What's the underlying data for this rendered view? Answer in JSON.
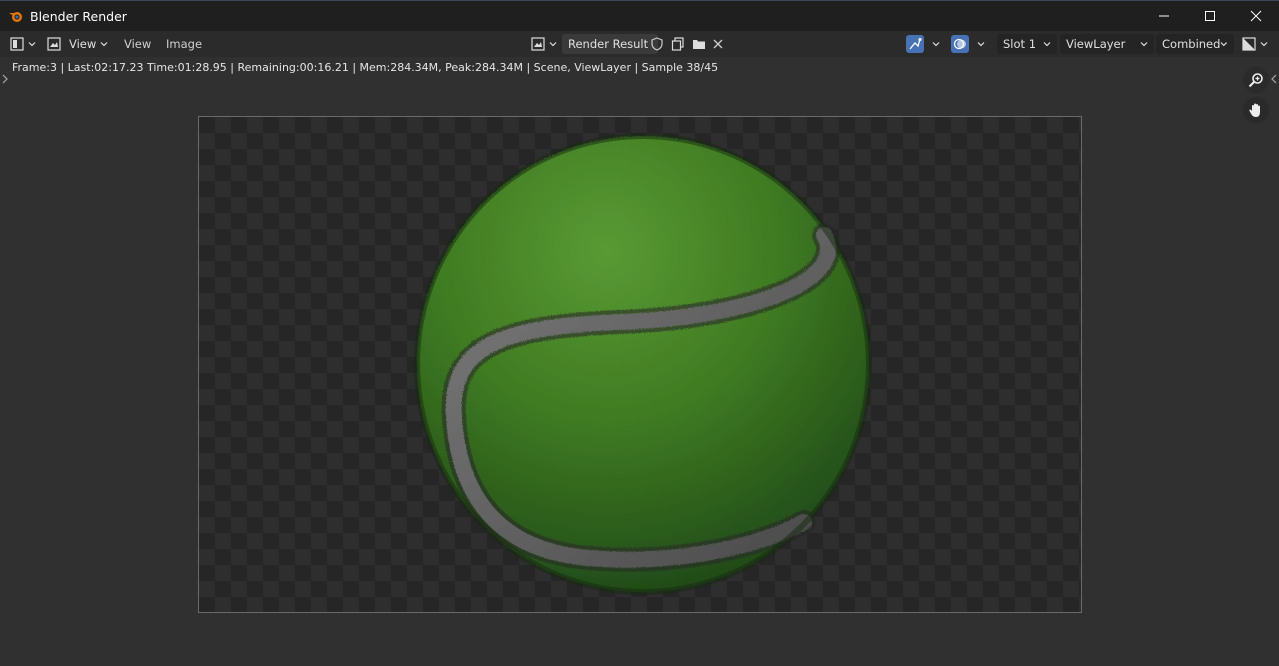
{
  "window": {
    "title": "Blender Render",
    "controls": [
      "minimize-icon",
      "maximize-icon",
      "close-icon"
    ]
  },
  "header": {
    "editor_type_icon": "image-editor-icon",
    "view_mode_label": "View",
    "menus": [
      "View",
      "Image"
    ],
    "image_name": "Render Result",
    "image_icons": [
      "fake-user-shield-icon",
      "duplicate-icon",
      "open-folder-icon",
      "unlink-close-icon"
    ],
    "overlay_icon": "gizmo-icon",
    "display_icon": "overlay-icon",
    "slot": "Slot 1",
    "view_layer": "ViewLayer",
    "pass": "Combined",
    "display_channels_icon": "display-channels-icon"
  },
  "info": {
    "text": "Frame:3 | Last:02:17.23 Time:01:28.95 | Remaining:00:16.21 | Mem:284.34M, Peak:284.34M | Scene, ViewLayer | Sample 38/45"
  },
  "tools": [
    "zoom-icon",
    "hand-pan-icon"
  ],
  "colors": {
    "accent_blue": "#4772b3",
    "grass_green": "#3f7a22",
    "seam_gray": "#6a6a6a"
  }
}
